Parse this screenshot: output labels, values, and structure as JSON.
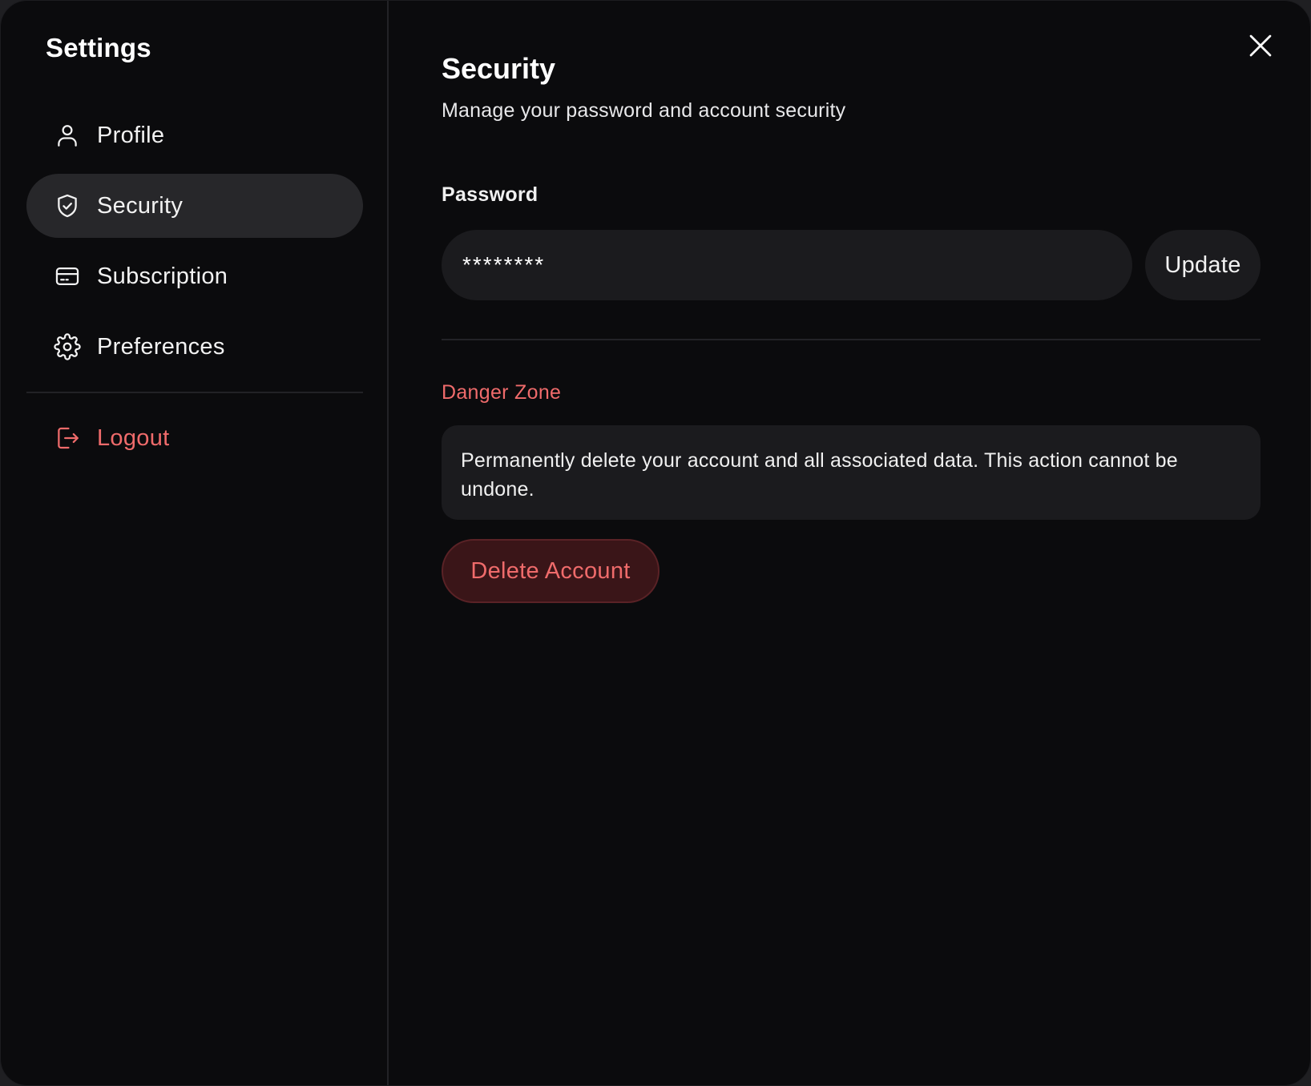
{
  "sidebar": {
    "title": "Settings",
    "items": [
      {
        "label": "Profile",
        "icon": "user-icon",
        "active": false
      },
      {
        "label": "Security",
        "icon": "shield-icon",
        "active": true
      },
      {
        "label": "Subscription",
        "icon": "credit-card-icon",
        "active": false
      },
      {
        "label": "Preferences",
        "icon": "gear-icon",
        "active": false
      }
    ],
    "logout": {
      "label": "Logout",
      "icon": "logout-icon",
      "color": "#ef6b6b"
    }
  },
  "main": {
    "title": "Security",
    "subtitle": "Manage your password and account security",
    "password": {
      "label": "Password",
      "value": "********",
      "update_label": "Update"
    },
    "danger_zone": {
      "title": "Danger Zone",
      "description": "Permanently delete your account and all associated data. This action cannot be undone.",
      "delete_label": "Delete Account"
    }
  },
  "colors": {
    "background": "#0b0b0d",
    "surface": "#1b1b1e",
    "active_item": "#27272a",
    "danger": "#ef6b6b",
    "danger_bg": "#3a1518"
  }
}
